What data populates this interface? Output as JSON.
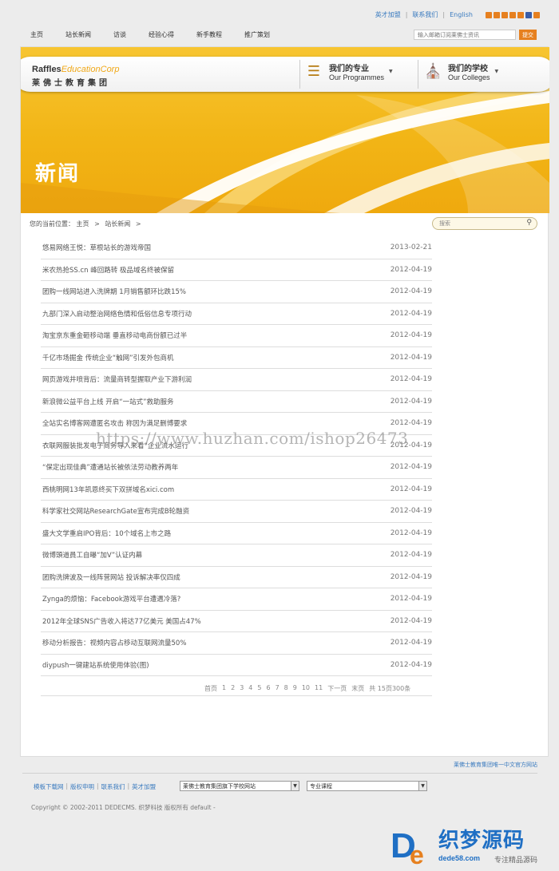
{
  "top_links": {
    "join": "英才加盟",
    "contact": "联系我们",
    "english": "English"
  },
  "nav": [
    "主页",
    "站长新闻",
    "访谈",
    "经验心得",
    "新手教程",
    "推广策划"
  ],
  "top_search": {
    "placeholder": "输入邮箱订阅莱佛士资讯",
    "button": "提交"
  },
  "banner": {
    "logo_en_1": "Raffles",
    "logo_en_2": "Education",
    "logo_en_3": "Corp",
    "logo_cn": "莱佛士教育集团",
    "programmes_cn": "我们的专业",
    "programmes_en": "Our Programmes",
    "colleges_cn": "我们的学校",
    "colleges_en": "Our Colleges",
    "title": "新闻"
  },
  "breadcrumb": {
    "label": "您的当前位置：",
    "home": "主页",
    "section": "站长新闻"
  },
  "side_search": {
    "placeholder": "搜索"
  },
  "news": [
    {
      "title": "悠易网络王悦：草根站长的游戏帝国",
      "date": "2013-02-21"
    },
    {
      "title": "米农热抢SS.cn 峰回路转 极品域名终被保留",
      "date": "2012-04-19"
    },
    {
      "title": "团购一线网站进入洗牌期 1月销售额环比跌15%",
      "date": "2012-04-19"
    },
    {
      "title": "九部门深入启动整治网络色情和低俗信息专项行动",
      "date": "2012-04-19"
    },
    {
      "title": "淘宝京东重金砸移动端 垂直移动电商份额已过半",
      "date": "2012-04-19"
    },
    {
      "title": "千亿市场掘金 传统企业“触网”引发外包商机",
      "date": "2012-04-19"
    },
    {
      "title": "网页游戏井喷背后：流量商转型握取产业下游利润",
      "date": "2012-04-19"
    },
    {
      "title": "新浪微公益平台上线 开启“一站式”救助服务",
      "date": "2012-04-19"
    },
    {
      "title": "全站实名博客网遭匿名攻击 称因为满足删博要求",
      "date": "2012-04-19"
    },
    {
      "title": "衣联网服装批发电子商务导入来看“企业流水运行",
      "date": "2012-04-19"
    },
    {
      "title": "“保定出现佳典”遭通站长被依法劳动教养两年",
      "date": "2012-04-19"
    },
    {
      "title": "西桃明网13年凯恩终买下双拼域名xici.com",
      "date": "2012-04-19"
    },
    {
      "title": "科学家社交网站ResearchGate宣布完成B轮融资",
      "date": "2012-04-19"
    },
    {
      "title": "盛大文学重启IPO背后：10个域名上市之路",
      "date": "2012-04-19"
    },
    {
      "title": "微博頭道員工自曝“加V”认证内幕",
      "date": "2012-04-19"
    },
    {
      "title": "团购洗牌波及一线阵营网站 投诉解决率仅四成",
      "date": "2012-04-19"
    },
    {
      "title": "Zynga的烦恼：Facebook游戏平台遭遇冷落?",
      "date": "2012-04-19"
    },
    {
      "title": "2012年全球SNS广告收入将达77亿美元 美国占47%",
      "date": "2012-04-19"
    },
    {
      "title": "移动分析报告：视频内容占移动互联网流量50%",
      "date": "2012-04-19"
    },
    {
      "title": "diypush一键建站系统使用体验(图)",
      "date": "2012-04-19"
    }
  ],
  "pager": {
    "first": "首页",
    "pages": [
      "1",
      "2",
      "3",
      "4",
      "5",
      "6",
      "7",
      "8",
      "9",
      "10",
      "11"
    ],
    "next": "下一页",
    "last": "末页",
    "summary": "共 15页300条"
  },
  "watermark": "https://www.huzhan.com/ishop26473",
  "footer": {
    "official": "莱佛士教育集团唯一中文官方网站",
    "links": [
      "模板下载网",
      "版权申明",
      "联系我们",
      "英才加盟"
    ],
    "select1": "莱佛士教育集团旗下学校网站",
    "select2": "专业课程",
    "copyright": "Copyright © 2002-2011 DEDECMS. 织梦科技 版权所有 default -"
  },
  "brand": {
    "name": "织梦源码",
    "url": "dede58.com",
    "tagline": "专注精品源码"
  }
}
